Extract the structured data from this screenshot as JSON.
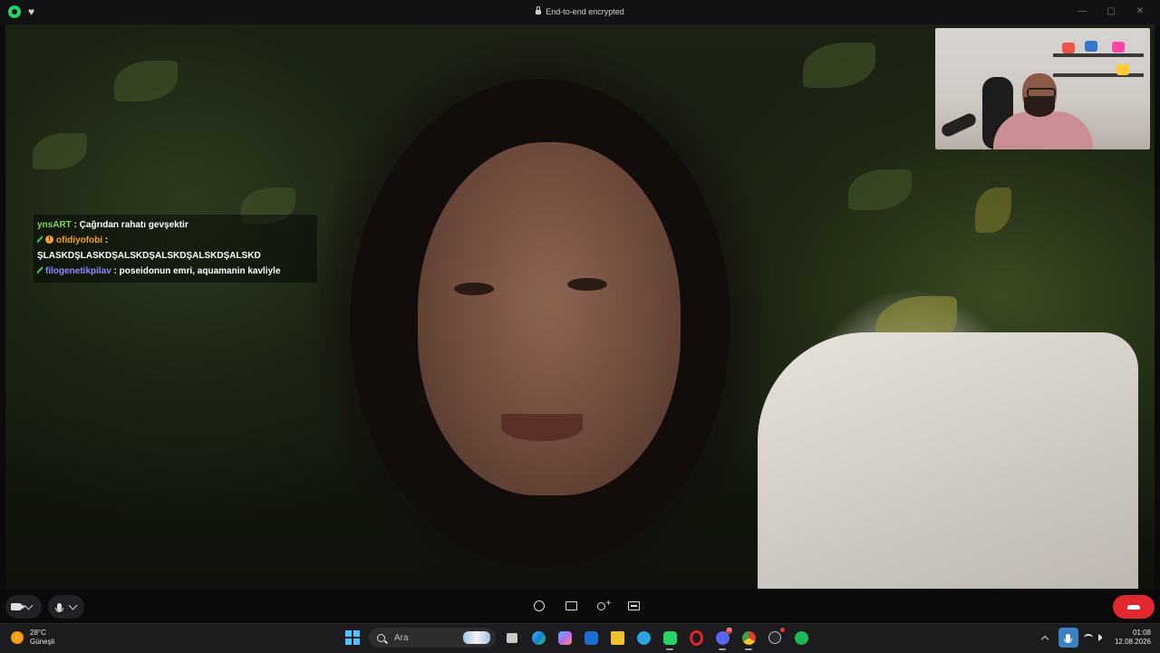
{
  "titlebar": {
    "title": "End-to-end encrypted",
    "left_icons": [
      "whatsapp-icon",
      "heart-icon"
    ],
    "controls": [
      "minimize-icon",
      "maximize-icon",
      "close-icon"
    ]
  },
  "chat": {
    "messages": [
      {
        "user": "ynsART",
        "text": " : Çağrıdan rahatı gevşektir",
        "color": "#7ed957"
      },
      {
        "user": "ofidiyofobi",
        "text": " :",
        "color": "#f5a623",
        "continued": "ŞLASKDŞLASKDŞALSKDŞALSKDŞALSKDŞALSKD"
      },
      {
        "user": "filogenetikpilav",
        "text": " : poseidonun emri, aquamanin kavliyle",
        "color": "#8a8aff"
      }
    ]
  },
  "call_controls": {
    "left": [
      "camera-icon",
      "mic-icon"
    ],
    "center": [
      "emoji-icon",
      "screen-share-icon",
      "add-participant-icon",
      "captions-icon"
    ],
    "end_call_color": "#e0282e"
  },
  "taskbar": {
    "weather": {
      "temp": "28°C",
      "condition": "Güneşli"
    },
    "search_placeholder": "Ara",
    "apps": [
      {
        "name": "task-view",
        "color": "#c9c9c9"
      },
      {
        "name": "edge",
        "color": "#1fa3e0"
      },
      {
        "name": "copilot",
        "color": "#b36cf2"
      },
      {
        "name": "outlook",
        "color": "#1a6fd6"
      },
      {
        "name": "file-explorer",
        "color": "#f2c12e"
      },
      {
        "name": "telegram",
        "color": "#2aa3e0"
      },
      {
        "name": "whatsapp",
        "color": "#25d366"
      },
      {
        "name": "opera",
        "color": "#e0242c"
      },
      {
        "name": "discord",
        "color": "#5865f2"
      },
      {
        "name": "chrome",
        "color": "#e8b82c"
      },
      {
        "name": "obs",
        "color": "#444"
      },
      {
        "name": "spotify",
        "color": "#1db954"
      }
    ],
    "discord_badge": "10",
    "time": "01:08",
    "date": "12.08.2026"
  }
}
